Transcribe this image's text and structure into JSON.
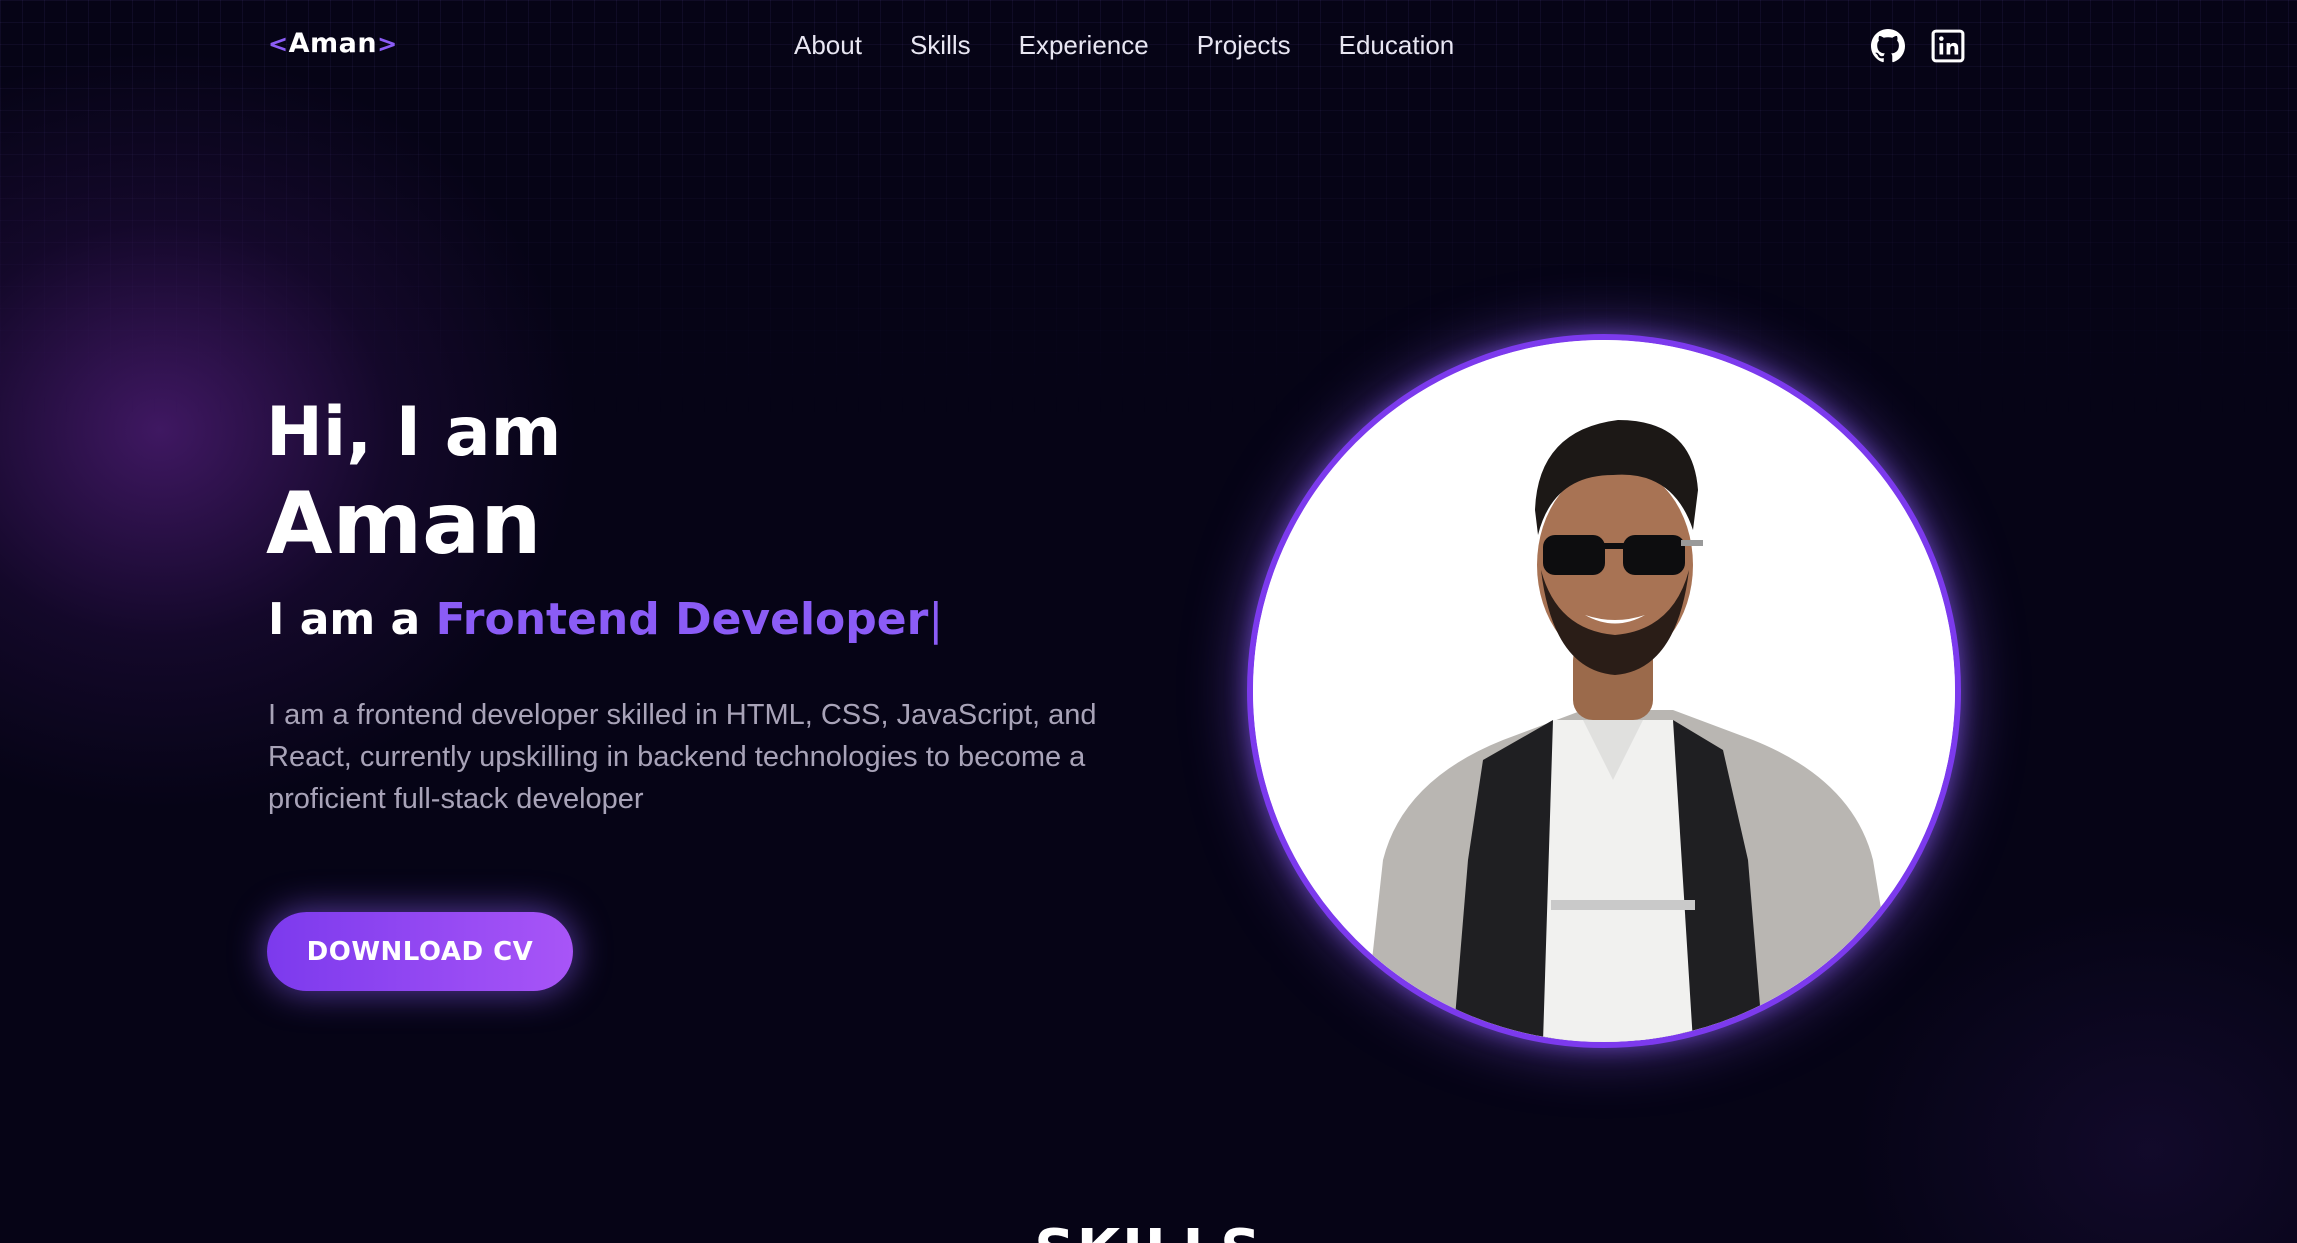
{
  "colors": {
    "background": "#060416",
    "accent": "#8b5cf6",
    "accent_dark": "#7c3aed",
    "text": "#ffffff",
    "muted_text": "#a8a3b8"
  },
  "nav": {
    "logo": {
      "open_bracket": "<",
      "text": "Aman",
      "close_bracket": ">"
    },
    "links": [
      {
        "label": "About"
      },
      {
        "label": "Skills"
      },
      {
        "label": "Experience"
      },
      {
        "label": "Projects"
      },
      {
        "label": "Education"
      }
    ],
    "socials": [
      {
        "icon": "github-icon"
      },
      {
        "icon": "linkedin-icon"
      }
    ]
  },
  "hero": {
    "greeting": "Hi, I am",
    "name": "Aman",
    "role_prefix": "I am a ",
    "role_highlight": "Frontend Developer",
    "role_cursor": "|",
    "bio": "I am a frontend developer skilled in HTML, CSS, JavaScript, and React, currently upskilling in backend technologies to become a proficient full-stack developer",
    "cta_label": "DOWNLOAD CV",
    "portrait_icon": "profile-photo"
  },
  "next_section": {
    "title": "SKILLS"
  }
}
